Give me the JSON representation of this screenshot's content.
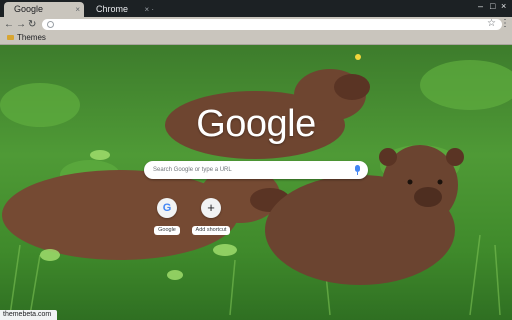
{
  "tabs": [
    {
      "title": "Google",
      "close": "×",
      "active": true
    },
    {
      "title": "Chrome",
      "close": "× ·",
      "active": false
    }
  ],
  "window_controls": {
    "minimize": "–",
    "maximize": "□",
    "close": "×"
  },
  "toolbar": {
    "back": "←",
    "forward": "→",
    "reload": "↻",
    "star": "☆",
    "menu": "⋮"
  },
  "bookmarks": [
    {
      "label": "Themes"
    }
  ],
  "ntp": {
    "logo": "Google",
    "search_placeholder": "Search Google or type a URL",
    "shortcuts": [
      {
        "label": "Google",
        "icon": "G",
        "icon_name": "google-icon"
      },
      {
        "label": "Add shortcut",
        "icon": "+",
        "icon_name": "plus-icon"
      }
    ]
  },
  "status_text": "themebeta.com",
  "colors": {
    "frame": "#1c2124",
    "toolbar": "#c9c5bd",
    "text_light": "#e8eaed"
  }
}
